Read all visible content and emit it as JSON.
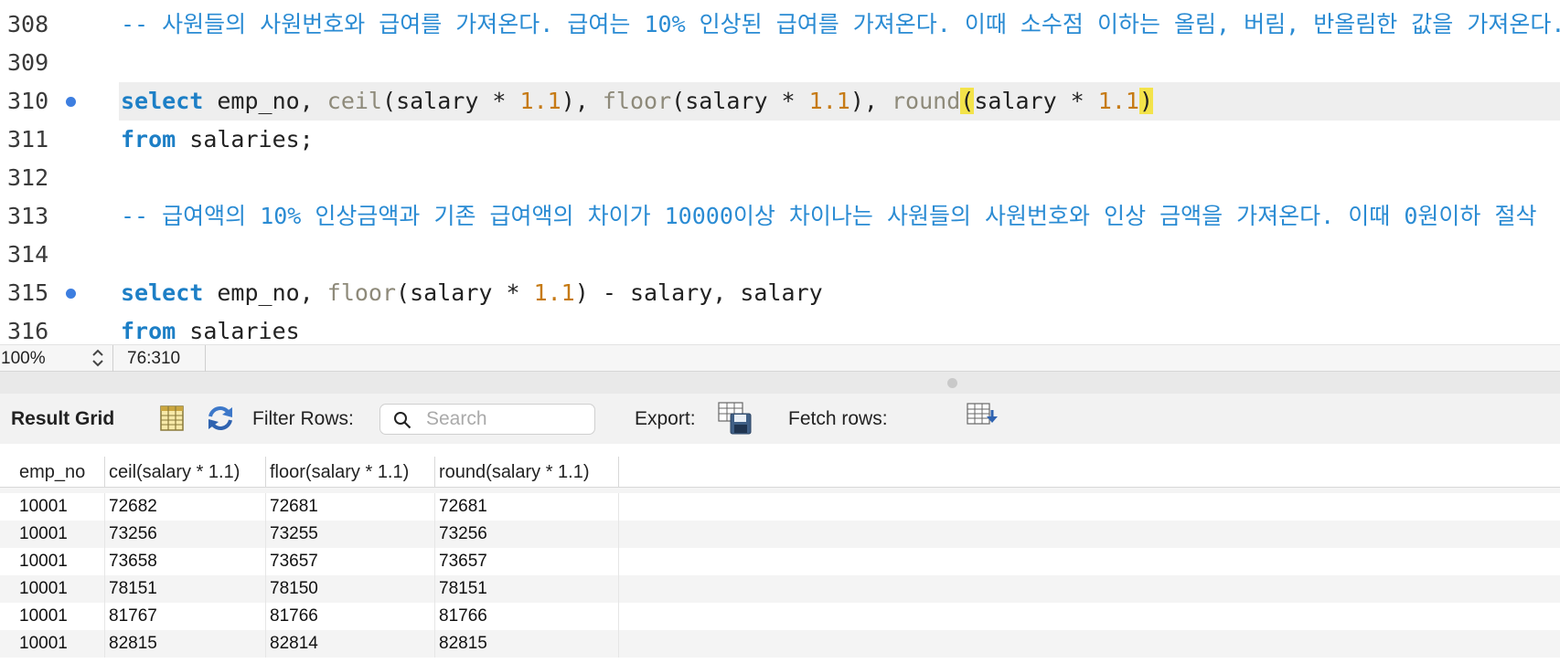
{
  "editor": {
    "lines": [
      {
        "num": "308",
        "text": "-- 사원들의 사원번호와 급여를 가져온다. 급여는 10% 인상된 급여를 가져온다. 이때 소수점 이하는 올림, 버림, 반올림한 값을 가져온다."
      },
      {
        "num": "309",
        "text": ""
      },
      {
        "num": "310",
        "text": "select emp_no, ceil(salary * 1.1), floor(salary * 1.1), round(salary * 1.1)"
      },
      {
        "num": "311",
        "text": "from salaries;"
      },
      {
        "num": "312",
        "text": ""
      },
      {
        "num": "313",
        "text": "-- 급여액의 10% 인상금액과 기존 급여액의 차이가 10000이상 차이나는 사원들의 사원번호와 인상 금액을 가져온다. 이때 0원이하 절삭"
      },
      {
        "num": "314",
        "text": ""
      },
      {
        "num": "315",
        "text": "select emp_no, floor(salary * 1.1) - salary, salary"
      },
      {
        "num": "316",
        "text": "from salaries"
      }
    ],
    "tokens": {
      "select": "select",
      "from": "from",
      "emp_no_sep": " emp_no, ",
      "ceil": "ceil",
      "floor": "floor",
      "round": "round",
      "open_paren": "(",
      "close_paren": ")",
      "salary_times": "salary * ",
      "factor": "1.1",
      "comma_sep": ", ",
      "minus_salary": " - salary, salary",
      "salaries_semicolon": " salaries;",
      "salaries": " salaries"
    }
  },
  "statusbar": {
    "zoom": "100%",
    "cursor": "76:310"
  },
  "toolbar": {
    "result_grid": "Result Grid",
    "filter_rows": "Filter Rows:",
    "search_placeholder": "Search",
    "search_value": "",
    "export": "Export:",
    "fetch_rows": "Fetch rows:"
  },
  "grid": {
    "columns": [
      "emp_no",
      "ceil(salary * 1.1)",
      "floor(salary * 1.1)",
      "round(salary * 1.1)"
    ],
    "rows": [
      [
        "10001",
        "72682",
        "72681",
        "72681"
      ],
      [
        "10001",
        "73256",
        "73255",
        "73256"
      ],
      [
        "10001",
        "73658",
        "73657",
        "73657"
      ],
      [
        "10001",
        "78151",
        "78150",
        "78151"
      ],
      [
        "10001",
        "81767",
        "81766",
        "81766"
      ],
      [
        "10001",
        "82815",
        "82814",
        "82815"
      ]
    ]
  },
  "colors": {
    "comment": "#2a8bd3",
    "keyword": "#1d7fc6",
    "function": "#8e8a7a",
    "number": "#c67a14",
    "bracket_highlight": "#f3e34a",
    "breakpoint": "#3d7ee0"
  },
  "icons": {
    "breakpoint": "breakpoint-dot-icon",
    "grid": "grid-view-icon",
    "refresh": "refresh-icon",
    "search": "search-icon",
    "export": "export-save-icon",
    "fetch": "fetch-rows-icon"
  }
}
